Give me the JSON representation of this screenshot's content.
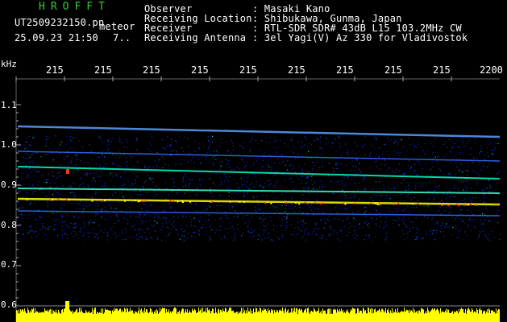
{
  "header": {
    "logo": "HROFFT",
    "filename": "UT2509232150.pn",
    "category": "meteor",
    "datetime": "25.09.23 21:50",
    "count": "7..",
    "labels": {
      "observer": "Observer",
      "location": "Receiving Location",
      "receiver": "Receiver",
      "antenna": "Receiving Antenna"
    },
    "values": {
      "observer": ": Masaki Kano",
      "location": ": Shibukawa, Gunma, Japan",
      "receiver": ": RTL-SDR SDR# 43dB L15 103.2MHz CW",
      "antenna": ": 3el Yagi(V) Az 330 for Vladivostok"
    }
  },
  "axes": {
    "y_unit": "kHz",
    "y_ticks": [
      "1.1",
      "1.0",
      "0.9",
      "0.8",
      "0.7",
      "0.6"
    ],
    "x_ticks": [
      "215",
      "215",
      "215",
      "215",
      "215",
      "215",
      "215",
      "215",
      "215",
      "2200"
    ]
  },
  "colors": {
    "logo": "#33cc33",
    "text": "#ffffff",
    "background": "#000000",
    "signal_strong": "#ff3030",
    "signal_mid": "#ffff00",
    "signal_low": "#00ffcc",
    "noise": "#1030ff",
    "amplitude_bar": "#ffff00"
  }
}
